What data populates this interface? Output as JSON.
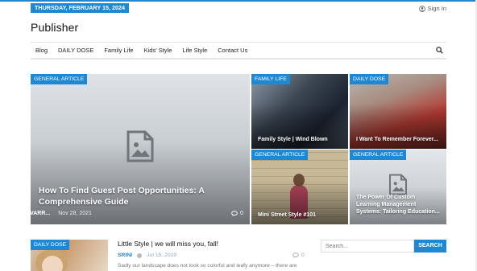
{
  "topbar": {
    "date": "THURSDAY, FEBRUARY 15, 2024",
    "signin_label": "Sign In",
    "accent": "#1e88d3"
  },
  "site": {
    "title": "Publisher"
  },
  "nav": {
    "items": [
      "Blog",
      "DAILY DOSE",
      "Family Life",
      "Kids' Style",
      "Life Style",
      "Contact Us"
    ],
    "search_icon": "search-icon"
  },
  "featured": {
    "main": {
      "tag": "GENERAL ARTICLE",
      "title": "How To Find Guest Post Opportunities: A Comprehensive Guide",
      "author": "SATISH VARR...",
      "date": "Nov 28, 2021",
      "comments": "0"
    },
    "tiles": [
      {
        "tag": "FAMILY LIFE",
        "title": "Family Style | Wind Blown"
      },
      {
        "tag": "DAILY DOSE",
        "title": "I Want To Remember Forever..."
      },
      {
        "tag": "GENERAL ARTICLE",
        "title": "Mini Street Style #101"
      },
      {
        "tag": "GENERAL ARTICLE",
        "title": "The Power Of Custom Learning Management Systems: Tailoring Education..."
      }
    ]
  },
  "post": {
    "tag": "DAILY DOSE",
    "title": "Little Style | we will miss you, fall!",
    "author": "SRINI",
    "date": "Jul 15, 2019",
    "comments": "0",
    "excerpt": "Sadly our landscape does not look so colorful and leafy anymore – there are"
  },
  "sidebar": {
    "search_placeholder": "Search...",
    "search_button": "SEARCH"
  }
}
